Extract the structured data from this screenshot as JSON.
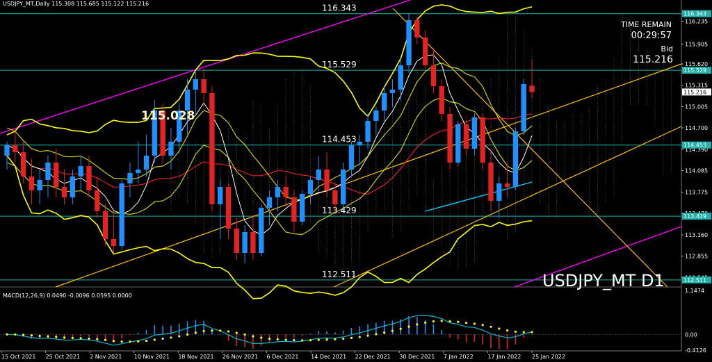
{
  "header": {
    "symbol_line": "USDJPY_MT,Daily  115.308 115.685 115.122 115.216",
    "macd_label": "MACD(12,26,9) 0.0490 -0.0096 0.0595 0.0000"
  },
  "timer": {
    "label": "TIME REMAIN",
    "value": "00:29:57",
    "bid_label": "Bid",
    "bid_value": "115.216"
  },
  "watermark": "USDJPY_MT D1",
  "peak_label": "115.028",
  "colors": {
    "background": "#000000",
    "bull": "#1e90ff",
    "bear": "#e32222",
    "bollinger": "#ffff00",
    "channel": "#ff00ff",
    "trendline": "#ffc000",
    "level": "#20b2aa",
    "ma_red": "#ff2020",
    "ma_white": "#ffffff",
    "ma_cyan": "#00d2ff",
    "macd_line": "#00bcd4",
    "macd_signal": "#ffff00",
    "price_box": "#20b2aa",
    "current_box": "#ffffff"
  },
  "chart_data": {
    "type": "candlestick",
    "price_axis": {
      "range": [
        112.41,
        116.54
      ],
      "ticks": [
        116.235,
        115.905,
        115.62,
        115.315,
        115.005,
        114.7,
        114.39,
        114.085,
        113.775,
        113.47,
        113.16,
        112.855,
        112.545
      ]
    },
    "date_labels": [
      "15 Oct 2021",
      "25 Oct 2021",
      "2 Nov 2021",
      "10 Nov 2021",
      "18 Nov 2021",
      "26 Nov 2021",
      "6 Dec 2021",
      "14 Dec 2021",
      "22 Dec 2021",
      "30 Dec 2021",
      "7 Jan 2022",
      "17 Jan 2022",
      "25 Jan 2022"
    ],
    "levels": [
      {
        "value": 116.343,
        "label": "116.343",
        "box": "116.343"
      },
      {
        "value": 115.529,
        "label": "115.529",
        "box": "115.529"
      },
      {
        "value": 114.453,
        "label": "114.453",
        "box": "114.453"
      },
      {
        "value": 113.429,
        "label": "113.429",
        "box": "113.429"
      },
      {
        "value": 112.511,
        "label": "112.511",
        "box": "112.511"
      }
    ],
    "current_price": {
      "value": 115.216,
      "label": "115.216"
    },
    "candles": [
      [
        114.3,
        114.5,
        114.1,
        114.45
      ],
      [
        114.45,
        114.7,
        114.2,
        114.35
      ],
      [
        114.35,
        114.5,
        113.9,
        114.0
      ],
      [
        114.0,
        114.25,
        113.6,
        113.8
      ],
      [
        113.8,
        114.1,
        113.6,
        113.95
      ],
      [
        113.95,
        114.3,
        113.7,
        114.2
      ],
      [
        114.2,
        114.4,
        113.7,
        113.85
      ],
      [
        113.85,
        114.1,
        113.6,
        113.7
      ],
      [
        113.7,
        114.1,
        113.6,
        114.0
      ],
      [
        114.0,
        114.3,
        113.8,
        114.15
      ],
      [
        114.15,
        114.3,
        113.7,
        113.8
      ],
      [
        113.8,
        114.0,
        113.4,
        113.5
      ],
      [
        113.5,
        113.6,
        113.0,
        113.1
      ],
      [
        113.1,
        113.5,
        112.9,
        113.0
      ],
      [
        113.0,
        113.95,
        112.95,
        113.9
      ],
      [
        113.9,
        114.2,
        113.7,
        114.05
      ],
      [
        114.05,
        114.5,
        113.9,
        114.1
      ],
      [
        114.1,
        114.6,
        114.0,
        114.3
      ],
      [
        114.3,
        115.1,
        114.2,
        114.95
      ],
      [
        114.95,
        115.05,
        114.2,
        114.3
      ],
      [
        114.3,
        114.7,
        114.1,
        114.5
      ],
      [
        114.5,
        115.05,
        114.4,
        114.95
      ],
      [
        114.95,
        115.4,
        114.6,
        115.25
      ],
      [
        115.25,
        115.5,
        114.9,
        115.4
      ],
      [
        115.4,
        115.55,
        115.0,
        115.2
      ],
      [
        115.2,
        115.3,
        113.5,
        113.6
      ],
      [
        113.6,
        113.95,
        113.1,
        113.85
      ],
      [
        113.85,
        113.9,
        113.1,
        113.25
      ],
      [
        113.25,
        113.4,
        112.8,
        112.9
      ],
      [
        112.9,
        113.3,
        112.75,
        113.2
      ],
      [
        113.2,
        113.45,
        112.8,
        112.9
      ],
      [
        112.9,
        113.6,
        112.85,
        113.55
      ],
      [
        113.55,
        113.8,
        113.3,
        113.7
      ],
      [
        113.7,
        113.95,
        113.5,
        113.85
      ],
      [
        113.85,
        114.0,
        113.6,
        113.7
      ],
      [
        113.7,
        113.8,
        113.2,
        113.35
      ],
      [
        113.35,
        113.8,
        113.3,
        113.75
      ],
      [
        113.75,
        114.0,
        113.6,
        113.95
      ],
      [
        113.95,
        114.3,
        113.8,
        114.1
      ],
      [
        114.1,
        114.35,
        113.7,
        113.8
      ],
      [
        113.8,
        113.9,
        113.5,
        113.6
      ],
      [
        113.6,
        114.2,
        113.5,
        114.1
      ],
      [
        114.1,
        114.5,
        114.0,
        114.45
      ],
      [
        114.45,
        114.6,
        114.2,
        114.5
      ],
      [
        114.5,
        114.9,
        114.4,
        114.8
      ],
      [
        114.8,
        115.0,
        114.6,
        114.95
      ],
      [
        114.95,
        115.3,
        114.8,
        115.2
      ],
      [
        115.2,
        115.4,
        115.0,
        115.25
      ],
      [
        115.25,
        115.7,
        115.1,
        115.6
      ],
      [
        115.6,
        116.35,
        115.5,
        116.25
      ],
      [
        116.25,
        116.3,
        115.9,
        116.0
      ],
      [
        116.0,
        116.1,
        115.55,
        115.6
      ],
      [
        115.6,
        115.85,
        115.2,
        115.3
      ],
      [
        115.3,
        115.4,
        114.8,
        114.9
      ],
      [
        114.9,
        115.0,
        114.1,
        114.2
      ],
      [
        114.2,
        114.8,
        114.15,
        114.75
      ],
      [
        114.75,
        114.8,
        114.3,
        114.4
      ],
      [
        114.4,
        114.9,
        114.3,
        114.85
      ],
      [
        114.85,
        114.9,
        114.1,
        114.2
      ],
      [
        114.2,
        114.4,
        113.5,
        113.65
      ],
      [
        113.65,
        114.0,
        113.4,
        113.9
      ],
      [
        113.9,
        114.2,
        113.7,
        113.85
      ],
      [
        113.85,
        114.7,
        113.8,
        114.65
      ],
      [
        114.65,
        115.4,
        114.6,
        115.33
      ],
      [
        115.308,
        115.685,
        115.122,
        115.216
      ]
    ]
  }
}
